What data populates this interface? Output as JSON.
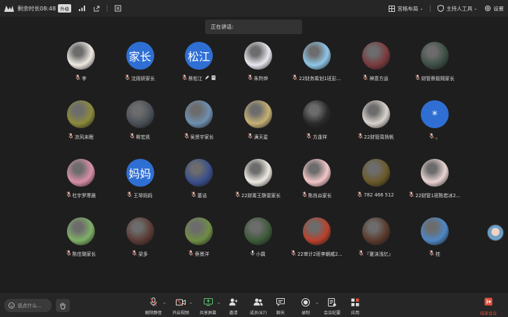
{
  "topbar": {
    "remaining_time": "剩余时长08:48",
    "upgrade_label": "升级",
    "layout_label": "宫格布局",
    "host_tools_label": "主持人工具",
    "settings_label": "设置"
  },
  "speaking_label": "正在讲话:",
  "participants": [
    {
      "name": "李",
      "avatar": "photo",
      "avatar_color": "#efe9e2"
    },
    {
      "name": "沈雨妍家长",
      "avatar": "text",
      "avatar_text": "家长"
    },
    {
      "name": "蔡松江",
      "avatar": "text",
      "avatar_text": "松江",
      "extra_icons": [
        "pen-icon",
        "doc-icon"
      ]
    },
    {
      "name": "朱羚烨",
      "avatar": "photo",
      "avatar_color": "#e9e7ef"
    },
    {
      "name": "22财务筹划1班彭...",
      "avatar": "photo",
      "avatar_color": "#8fc6e6"
    },
    {
      "name": "神意方运",
      "avatar": "photo",
      "avatar_color": "#7a3a3e"
    },
    {
      "name": "财管蔡毅翔家长",
      "avatar": "photo",
      "avatar_color": "#3d4f45"
    },
    {
      "name": "凉风未眠",
      "avatar": "photo",
      "avatar_color": "#8b8a3b"
    },
    {
      "name": "柳宏凯",
      "avatar": "photo",
      "avatar_color": "#4a5058"
    },
    {
      "name": "吴贤宇家长",
      "avatar": "photo",
      "avatar_color": "#6d8fb0"
    },
    {
      "name": "满天星",
      "avatar": "photo",
      "avatar_color": "#c6b074"
    },
    {
      "name": "方逢祥",
      "avatar": "photo",
      "avatar_color": "#2a2a2a"
    },
    {
      "name": "22财管周扬帆",
      "avatar": "photo",
      "avatar_color": "#d9d3cd"
    },
    {
      "name": "。",
      "avatar": "text",
      "avatar_text": "*"
    },
    {
      "name": "杜宇罗寒晨",
      "avatar": "photo",
      "avatar_color": "#d88fa8"
    },
    {
      "name": "王琴妈妈",
      "avatar": "text",
      "avatar_text": "妈妈"
    },
    {
      "name": "董诘",
      "avatar": "photo",
      "avatar_color": "#3a4f8c"
    },
    {
      "name": "22财筹王静雯家长",
      "avatar": "photo",
      "avatar_color": "#eeeae2"
    },
    {
      "name": "陈肖焱家长",
      "avatar": "photo",
      "avatar_color": "#f3c6c7"
    },
    {
      "name": "782 466 512",
      "avatar": "photo",
      "avatar_color": "#6b5a2a"
    },
    {
      "name": "22财管1班陈若冰2...",
      "avatar": "photo",
      "avatar_color": "#ead4d2"
    },
    {
      "name": "陈佳璐家长",
      "avatar": "photo",
      "avatar_color": "#7fb067"
    },
    {
      "name": "梁多",
      "avatar": "photo",
      "avatar_color": "#5b3b35"
    },
    {
      "name": "蔡景洋",
      "avatar": "photo",
      "avatar_color": "#6f8d45"
    },
    {
      "name": "小霖",
      "avatar": "photo",
      "avatar_color": "#3e5a3a",
      "mic_style": "active"
    },
    {
      "name": "22审计2班李朝威2...",
      "avatar": "photo",
      "avatar_color": "#b8412c"
    },
    {
      "name": "『夏沫浅忆』",
      "avatar": "photo",
      "avatar_color": "#5a3a2c"
    },
    {
      "name": "桂",
      "avatar": "photo",
      "avatar_color": "#4f87c4"
    }
  ],
  "bottombar": {
    "chat_placeholder": "说点什么...",
    "unmute": "解除静音",
    "start_video": "开启视频",
    "share_screen": "共享屏幕",
    "invite": "邀请",
    "members": "成员(87)",
    "chat": "聊天",
    "record": "录制",
    "minutes": "会议纪要",
    "apps": "应用",
    "leave": "结束会议"
  },
  "colors": {
    "background": "#1e1e1e",
    "bar": "#262626",
    "text_avatar": "#2f6fd4",
    "leave": "#e0533f"
  }
}
